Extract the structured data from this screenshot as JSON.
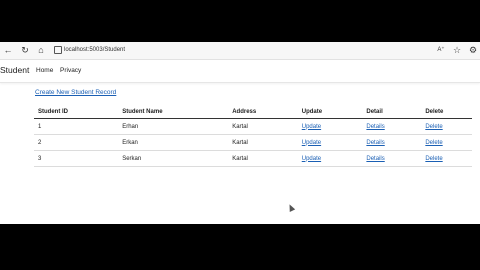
{
  "browser": {
    "url": "localhost:5003/Student",
    "icons": [
      "back-arrow-icon",
      "refresh-icon",
      "home-icon",
      "lock-icon",
      "read-aloud-icon",
      "favorites-icon",
      "extensions-icon"
    ]
  },
  "navbar": {
    "brand": "Student",
    "links": [
      "Home",
      "Privacy"
    ]
  },
  "main": {
    "create_link": "Create New Student Record",
    "table": {
      "headers": [
        "Student ID",
        "Student Name",
        "Address",
        "Update",
        "Detail",
        "Delete"
      ],
      "rows": [
        {
          "id": "1",
          "name": "Erhan",
          "address": "Kartal",
          "update": "Update",
          "detail": "Details",
          "delete": "Delete"
        },
        {
          "id": "2",
          "name": "Erkan",
          "address": "Kartal",
          "update": "Update",
          "detail": "Details",
          "delete": "Delete"
        },
        {
          "id": "3",
          "name": "Serkan",
          "address": "Kartal",
          "update": "Update",
          "detail": "Details",
          "delete": "Delete"
        }
      ]
    }
  },
  "colors": {
    "link": "#1a5fb4",
    "background": "#ffffff",
    "letterbox": "#000000"
  }
}
